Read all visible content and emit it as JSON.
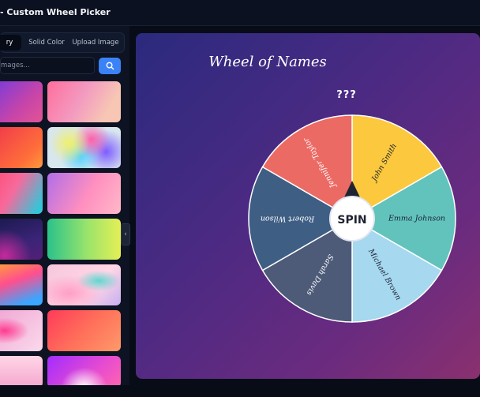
{
  "app": {
    "title": "- Custom Wheel Picker"
  },
  "tabs": [
    {
      "label": "ry",
      "active": true
    },
    {
      "label": "Solid Color",
      "active": false
    },
    {
      "label": "Upload Image",
      "active": false
    }
  ],
  "search": {
    "placeholder": "mages...",
    "button_icon": "search-icon"
  },
  "gallery": {
    "thumbnails": [
      "gradient-purple-pink",
      "gradient-pink-blush",
      "gradient-red-orange",
      "rainbow-smoke",
      "gradient-pink-teal",
      "gradient-blue-pink",
      "dark-purple-wave",
      "gradient-green-yellow",
      "gradient-orange-blue",
      "marble-pink-teal",
      "gradient-pink-swirl",
      "gradient-red-orange-2",
      "gradient-pink-bottom",
      "gradient-magenta-bottom"
    ]
  },
  "collapse_handle": {
    "icon": "chevron-left-icon"
  },
  "wheel": {
    "title": "Wheel of Names",
    "result": "???",
    "center_label": "SPIN",
    "segments": [
      {
        "name": "John Smith",
        "color": "#fcc83d"
      },
      {
        "name": "Emma Johnson",
        "color": "#62c3bd"
      },
      {
        "name": "Michael Brown",
        "color": "#a6d8ef"
      },
      {
        "name": "Sarah Davis",
        "color": "#4d5b78"
      },
      {
        "name": "Robert Wilson",
        "color": "#3f5e84"
      },
      {
        "name": "Jennifer Taylor",
        "color": "#ec6a64"
      }
    ]
  },
  "colors": {
    "accent": "#3b82f6",
    "panel": "#0d1322",
    "background": "#070c17"
  }
}
